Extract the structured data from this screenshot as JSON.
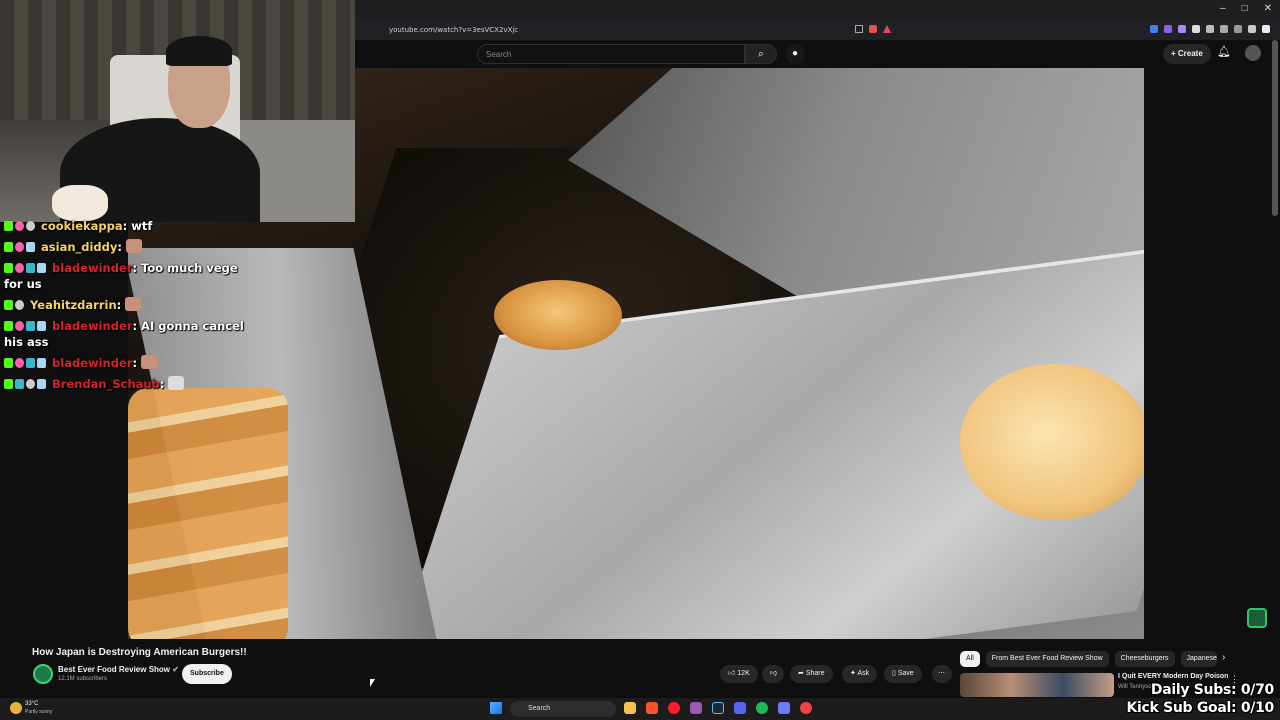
{
  "browser": {
    "url": "youtube.com/watch?v=3esVCX2vXjc",
    "window_controls": [
      "–",
      "□",
      "✕"
    ]
  },
  "youtube_header": {
    "search_placeholder": "Search",
    "search_icon": "search-icon",
    "mic_icon": "mic-icon",
    "create_label": "+ Create",
    "bell_icon": "bell-icon"
  },
  "chat": [
    {
      "user": "cookiekappa",
      "message": "wtf",
      "user_color": "#f6d36b"
    },
    {
      "user": "asian_diddy",
      "message": "",
      "user_color": "#f6d36b",
      "emote": true
    },
    {
      "user": "bladewinder",
      "message": "Too much vege for us",
      "user_color": "#d5232b"
    },
    {
      "user": "Yeahitzdarrin",
      "message": "",
      "user_color": "#f6d36b",
      "emote": true
    },
    {
      "user": "bladewinder",
      "message": "AI gonna cancel his ass",
      "user_color": "#d5232b"
    },
    {
      "user": "bladewinder",
      "message": "",
      "user_color": "#d5232b",
      "emote": true
    },
    {
      "user": "Brendan_Schaub",
      "message": "",
      "user_color": "#d5232b",
      "emote": true
    }
  ],
  "video": {
    "title": "How Japan is Destroying American Burgers!!",
    "channel": "Best Ever Food Review Show",
    "verified_icon": "verified-icon",
    "subscribers": "12.1M subscribers",
    "subscribe_label": "Subscribe",
    "likes": "12K",
    "share_label": "Share",
    "ask_label": "Ask",
    "save_label": "Save",
    "more_label": "⋯"
  },
  "chips": [
    "All",
    "From Best Ever Food Review Show",
    "Cheeseburgers",
    "Japanese c"
  ],
  "recommendation": {
    "title": "I Quit EVERY Modern Day Poison",
    "channel": "Will Tennyson"
  },
  "overlay": {
    "daily_subs": "Daily Subs: 0/70",
    "kick_goal": "Kick Sub Goal: 0/10"
  },
  "taskbar": {
    "temperature": "33°C",
    "weather": "Partly sunny",
    "search_label": "Search"
  }
}
